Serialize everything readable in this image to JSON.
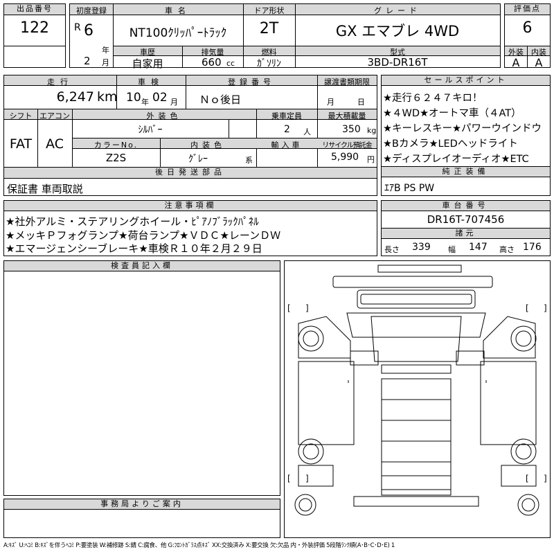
{
  "lot": {
    "label": "出品番号",
    "value": "122"
  },
  "first_reg": {
    "label": "初度登録",
    "era": "R",
    "year": "6",
    "year_unit": "年",
    "month": "2",
    "month_unit": "月"
  },
  "car_name": {
    "label": "車名",
    "value": "NT100ｸﾘｯﾊﾟｰﾄﾗｯｸ"
  },
  "door": {
    "label": "ドア形状",
    "value": "2T"
  },
  "grade": {
    "label": "グレード",
    "value": "GX エマブレ 4WD"
  },
  "score": {
    "label": "評価点",
    "value": "6"
  },
  "history": {
    "label": "車歴",
    "value": "自家用"
  },
  "displacement": {
    "label": "排気量",
    "value": "660",
    "unit": "cc"
  },
  "fuel": {
    "label": "燃料",
    "value": "ｶﾞｿﾘﾝ"
  },
  "model": {
    "label": "型式",
    "value": "3BD-DR16T"
  },
  "exterior_grade": {
    "label": "外装",
    "value": "A"
  },
  "interior_grade": {
    "label": "内装",
    "value": "A"
  },
  "mileage": {
    "label": "走行",
    "value": "6,247",
    "unit": "km"
  },
  "inspection": {
    "label": "車検",
    "year": "10",
    "year_unit": "年",
    "month": "02",
    "month_unit": "月"
  },
  "reg_no": {
    "label": "登録番号",
    "value": "Ｎｏ後日"
  },
  "transfer": {
    "label": "譲渡書類期限",
    "month_unit": "月",
    "day_unit": "日"
  },
  "sales_points": {
    "label": "セールスポイント",
    "lines": [
      "★走行６２４７キロ！",
      "★４WD★オートマ車（４AT）",
      "★キーレスキー★パワーウインドウ",
      "★Bカメラ★LEDヘッドライト",
      "★ディスプレイオーディオ★ETC"
    ]
  },
  "shift": {
    "label": "シフト",
    "value": "FAT"
  },
  "aircon": {
    "label": "エアコン",
    "value": "AC"
  },
  "exterior_color": {
    "label": "外装色",
    "value": "ｼﾙﾊﾞｰ"
  },
  "capacity": {
    "label": "乗車定員",
    "value": "2",
    "unit": "人"
  },
  "max_load": {
    "label": "最大積載量",
    "value": "350",
    "unit": "kg"
  },
  "color_no": {
    "label": "カラーNo.",
    "value": "Z2S"
  },
  "interior_color": {
    "label": "内装色",
    "value": "ｸﾞﾚｰ",
    "unit": "系"
  },
  "import": {
    "label": "輸入車"
  },
  "recycle": {
    "label": "リサイクル預託金",
    "value": "5,990",
    "unit": "円"
  },
  "later_parts": {
    "label": "後日発送部品",
    "value": "保証書 車両取説"
  },
  "equipment": {
    "label": "純正装備",
    "value": "ｴｱB PS PW"
  },
  "notes": {
    "label": "注意事項欄",
    "lines": [
      "★社外アルミ・ステアリングホイール・ﾋﾟｱﾉﾌﾞﾗｯｸﾊﾟﾈﾙ",
      "★メッキＰフォグランプ★荷台ランプ★ＶＤＣ★レーンＤＷ",
      "★エマージェンシーブレーキ★車検Ｒ１０年２月２９日"
    ]
  },
  "chassis": {
    "label": "車台番号",
    "value": "DR16T-707456"
  },
  "specs": {
    "label": "諸元",
    "length_label": "長さ",
    "length": "339",
    "width_label": "幅",
    "width": "147",
    "height_label": "高さ",
    "height": "176"
  },
  "inspector": {
    "label": "検査員記入欄"
  },
  "office": {
    "label": "事務局よりご案内"
  },
  "legend": "A:ｷｽﾞ U:ﾍｺﾐ B:ｷｽﾞを伴うﾍｺﾐ P:要塗装 W:補修跡 S:錆 C:腐食、他 G:ﾌﾛﾝﾄｶﾞﾗｽ点ｷｽﾞ XX:交換済み X:要交換 欠:欠品 内・外装評価 5段階ﾗﾝｸ順(A･B･C･D･E) 1"
}
